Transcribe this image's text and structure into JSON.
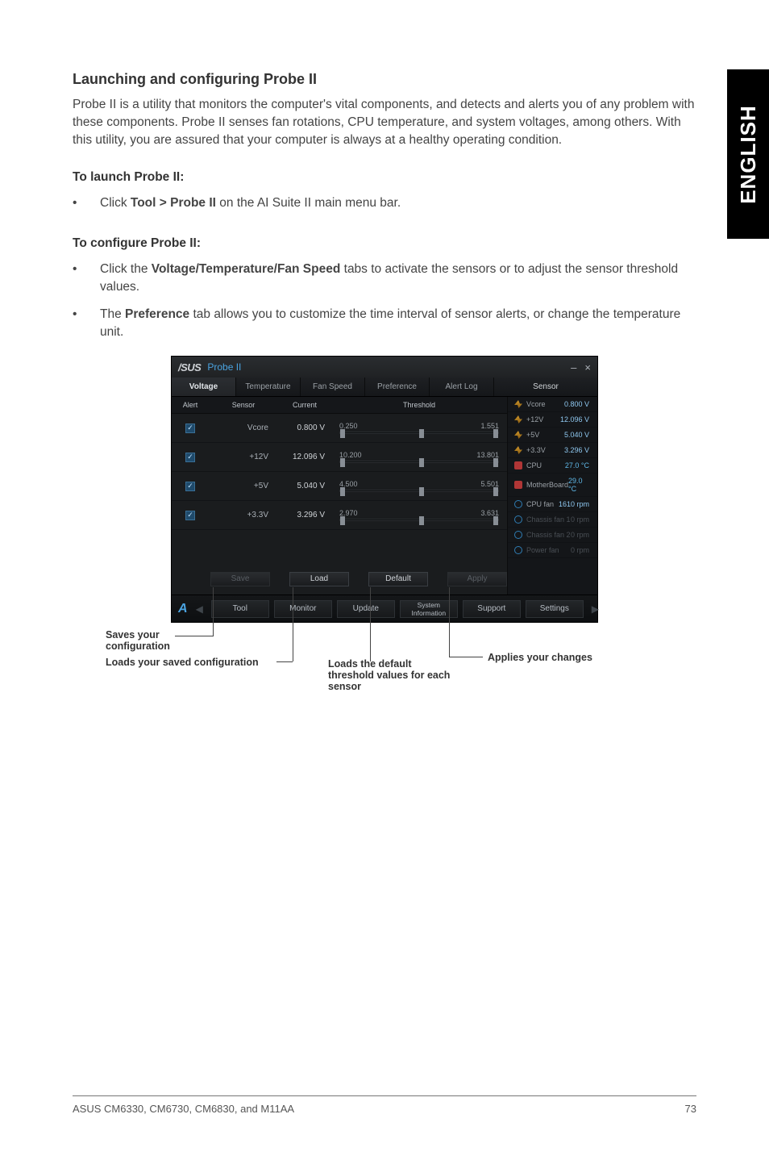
{
  "sideTab": "ENGLISH",
  "heading": "Launching and configuring Probe II",
  "intro": "Probe II is a utility that monitors the computer's vital components, and detects and alerts you of any problem with these components. Probe II senses fan rotations, CPU temperature, and system voltages, among others. With this utility, you are assured that your computer is always at a healthy operating condition.",
  "toLaunch": "To launch Probe II:",
  "launchBullet_pre": "Click ",
  "launchBullet_bold": "Tool > Probe II",
  "launchBullet_post": " on the AI Suite II main menu bar.",
  "toConfigure": "To configure Probe II:",
  "cfgBullet1_pre": "Click the ",
  "cfgBullet1_bold": "Voltage/Temperature/Fan Speed",
  "cfgBullet1_post": " tabs to activate the sensors or to adjust the sensor threshold values.",
  "cfgBullet2_pre": "The ",
  "cfgBullet2_bold": "Preference",
  "cfgBullet2_post": " tab allows you to customize the time interval of sensor alerts, or change the temperature unit.",
  "window": {
    "brand": "/SUS",
    "title": "Probe II",
    "minimize": "–",
    "close": "×",
    "tabs": {
      "voltage": "Voltage",
      "temperature": "Temperature",
      "fanSpeed": "Fan Speed",
      "preference": "Preference",
      "alertLog": "Alert Log"
    },
    "rightHead": "Sensor",
    "cols": {
      "alert": "Alert",
      "sensor": "Sensor",
      "current": "Current",
      "threshold": "Threshold"
    },
    "rows": [
      {
        "name": "Vcore",
        "current": "0.800 V",
        "low": "0.250",
        "high": "1.551"
      },
      {
        "name": "+12V",
        "current": "12.096 V",
        "low": "10.200",
        "high": "13.801"
      },
      {
        "name": "+5V",
        "current": "5.040 V",
        "low": "4.500",
        "high": "5.501"
      },
      {
        "name": "+3.3V",
        "current": "3.296 V",
        "low": "2.970",
        "high": "3.631"
      }
    ],
    "btns": {
      "save": "Save",
      "load": "Load",
      "default": "Default",
      "apply": "Apply"
    },
    "rightPanel": [
      {
        "icon": "volt",
        "name": "Vcore",
        "val": "0.800 V",
        "cls": ""
      },
      {
        "icon": "volt",
        "name": "+12V",
        "val": "12.096 V",
        "cls": ""
      },
      {
        "icon": "volt",
        "name": "+5V",
        "val": "5.040 V",
        "cls": ""
      },
      {
        "icon": "volt",
        "name": "+3.3V",
        "val": "3.296 V",
        "cls": ""
      },
      {
        "icon": "temp",
        "name": "CPU",
        "val": "27.0 °C",
        "cls": "temp"
      },
      {
        "icon": "temp",
        "name": "MotherBoard",
        "val": "29.0 °C",
        "cls": "temp"
      },
      {
        "icon": "fan",
        "name": "CPU fan",
        "val": "1610 rpm",
        "cls": ""
      },
      {
        "icon": "fan",
        "name": "Chassis fan 1",
        "val": "0 rpm",
        "cls": "dim"
      },
      {
        "icon": "fan",
        "name": "Chassis fan 2",
        "val": "0 rpm",
        "cls": "dim"
      },
      {
        "icon": "fan",
        "name": "Power fan",
        "val": "0 rpm",
        "cls": "dim"
      }
    ],
    "mainBar": {
      "tool": "Tool",
      "monitor": "Monitor",
      "update": "Update",
      "sys1": "System",
      "sys2": "Information",
      "support": "Support",
      "settings": "Settings"
    }
  },
  "callouts": {
    "saves": "Saves your configuration",
    "loads": "Loads your saved configuration",
    "default": "Loads the default threshold values for each sensor",
    "applies": "Applies your changes"
  },
  "footer": {
    "left": "ASUS CM6330, CM6730, CM6830, and M11AA",
    "right": "73"
  }
}
